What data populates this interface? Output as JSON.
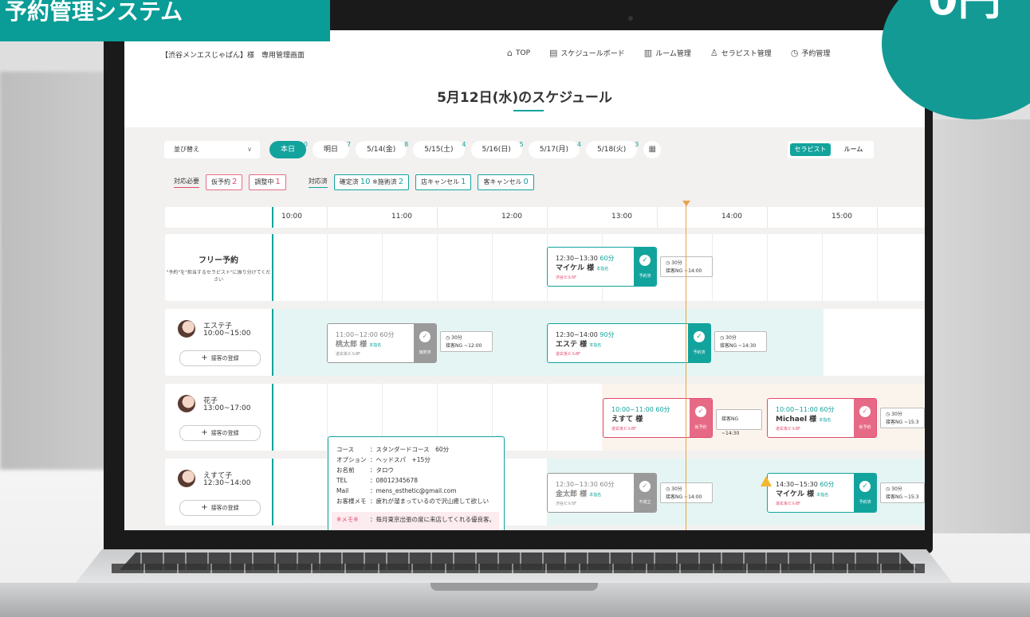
{
  "banner": {
    "text": "予約管理システム"
  },
  "badge": {
    "text": "0円"
  },
  "header": {
    "site_title": "【渋谷メンエスじゃぱん】様　専用管理画面",
    "nav": [
      {
        "label": "TOP",
        "icon": "home-icon"
      },
      {
        "label": "スケジュールボード",
        "icon": "clipboard-icon"
      },
      {
        "label": "ルーム管理",
        "icon": "door-icon"
      },
      {
        "label": "セラピスト管理",
        "icon": "person-icon"
      },
      {
        "label": "予約管理",
        "icon": "clock-icon"
      }
    ]
  },
  "page_title": "5月12日(水)のスケジュール",
  "filters": {
    "sort_label": "並び替え",
    "dates": [
      {
        "label": "本日",
        "count": "10"
      },
      {
        "label": "明日",
        "count": "7"
      },
      {
        "label": "5/14(金)",
        "count": "8"
      },
      {
        "label": "5/15(土)",
        "count": "4"
      },
      {
        "label": "5/16(日)",
        "count": "5"
      },
      {
        "label": "5/17(月)",
        "count": "4"
      },
      {
        "label": "5/18(火)",
        "count": "3"
      }
    ],
    "view_toggle": [
      "セラピスト",
      "ルーム"
    ]
  },
  "status": {
    "need_label": "対応必要",
    "done_label": "対応済",
    "chips_need": [
      {
        "label": "仮予約",
        "count": "2"
      },
      {
        "label": "調整中",
        "count": "1"
      }
    ],
    "chips_done": [
      {
        "label": "確定済",
        "count": "10",
        "extra": "※施術済",
        "extra_count": "2"
      },
      {
        "label": "店キャンセル",
        "count": "1"
      },
      {
        "label": "客キャンセル",
        "count": "0"
      }
    ]
  },
  "hours": [
    "10:00",
    "11:00",
    "12:00",
    "13:00",
    "14:00",
    "15:00"
  ],
  "rows": {
    "free": {
      "title": "フリー予約",
      "note": "\"予約\"を\"担当するセラピスト\"に振り分けてください"
    },
    "therapists": [
      {
        "name": "エステ子",
        "hours": "10:00~15:00",
        "register": "接客の登録"
      },
      {
        "name": "花子",
        "hours": "13:00~17:00",
        "register": "接客の登録"
      },
      {
        "name": "えすて子",
        "hours": "12:30~14:00",
        "register": "接客の登録"
      }
    ]
  },
  "cards": [
    {
      "time": "12:30~13:30",
      "dur": "60分",
      "name": "マイケル 様",
      "tag": "本指名",
      "place": "渋谷ビル5F",
      "status": "予約済"
    },
    {
      "time": "11:00~12:00",
      "dur": "60分",
      "name": "桃太郎 様",
      "tag": "本指名",
      "place": "道玄坂ビル8F",
      "status": "施術済"
    },
    {
      "time": "12:30~14:00",
      "dur": "90分",
      "name": "エステ 様",
      "tag": "本指名",
      "place": "道玄坂ビル8F",
      "status": "予約済"
    },
    {
      "time": "10:00~11:00",
      "dur": "60分",
      "name": "えすて 様",
      "tag": "",
      "place": "道玄坂ビル8F",
      "status": "仮予約"
    },
    {
      "time": "10:00~11:00",
      "dur": "60分",
      "name": "Michael 様",
      "tag": "本指名",
      "place": "道玄坂ビル8F",
      "status": "仮予約"
    },
    {
      "time": "12:30~13:30",
      "dur": "60分",
      "name": "金太郎 様",
      "tag": "本指名",
      "place": "渋谷ビル5F",
      "status": "不成立"
    },
    {
      "time": "14:30~15:30",
      "dur": "60分",
      "name": "マイケル 様",
      "tag": "本指名",
      "place": "道玄坂ビル8F",
      "status": "予約済"
    }
  ],
  "intervals": [
    {
      "mins": "30分",
      "ng": "接客NG ~14:00"
    },
    {
      "mins": "30分",
      "ng": "接客NG ~12:00"
    },
    {
      "mins": "30分",
      "ng": "接客NG ~14:30"
    },
    {
      "mins": "",
      "ng": "接客NG ~14:30"
    },
    {
      "mins": "30分",
      "ng": "接客NG ~15:3"
    },
    {
      "mins": "30分",
      "ng": "接客NG ~14:00"
    },
    {
      "mins": "30分",
      "ng": "接客NG ~15:3"
    }
  ],
  "popup": {
    "course_k": "コース",
    "course_v": "：スタンダードコース　60分",
    "option_k": "オプション",
    "option_v": "：ヘッドスパ　+15分",
    "name_k": "お名前",
    "name_v": "：タロウ",
    "tel_k": "TEL",
    "tel_v": "：08012345678",
    "mail_k": "Mail",
    "mail_v": "：mens_esthetic@gmail.com",
    "memo_k": "お客様メモ",
    "memo_v": "：疲れが溜まっているので沢山癒して欲しい",
    "note_k": "※メモ※",
    "note_v": "：毎月東京出張の度に来店してくれる優良客。"
  },
  "colors": {
    "accent": "#13a39d",
    "pink": "#e0486c",
    "now": "#e9a24a"
  }
}
